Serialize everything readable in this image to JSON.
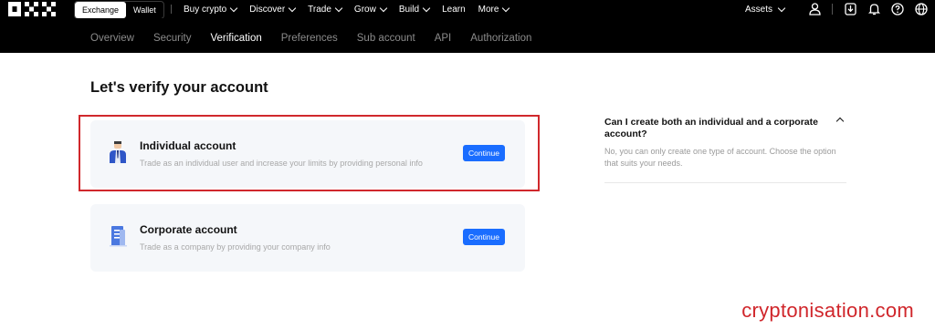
{
  "topnav": {
    "mode_tabs": [
      {
        "label": "Exchange",
        "active": true
      },
      {
        "label": "Wallet",
        "active": false
      }
    ],
    "menu": [
      {
        "label": "Buy crypto",
        "has_dropdown": true
      },
      {
        "label": "Discover",
        "has_dropdown": true
      },
      {
        "label": "Trade",
        "has_dropdown": true
      },
      {
        "label": "Grow",
        "has_dropdown": true
      },
      {
        "label": "Build",
        "has_dropdown": true
      },
      {
        "label": "Learn",
        "has_dropdown": false
      },
      {
        "label": "More",
        "has_dropdown": true
      }
    ],
    "assets_label": "Assets",
    "icons": [
      "user-icon",
      "download-icon",
      "bell-icon",
      "help-icon",
      "globe-icon"
    ]
  },
  "subnav": {
    "tabs": [
      {
        "label": "Overview",
        "active": false
      },
      {
        "label": "Security",
        "active": false
      },
      {
        "label": "Verification",
        "active": true
      },
      {
        "label": "Preferences",
        "active": false
      },
      {
        "label": "Sub account",
        "active": false
      },
      {
        "label": "API",
        "active": false
      },
      {
        "label": "Authorization",
        "active": false
      }
    ]
  },
  "main": {
    "title": "Let's verify your account",
    "cards": {
      "individual": {
        "title": "Individual account",
        "description": "Trade as an individual user and increase your limits by providing personal info",
        "button": "Continue",
        "highlighted": true
      },
      "corporate": {
        "title": "Corporate account",
        "description": "Trade as a company by providing your company info",
        "button": "Continue",
        "highlighted": false
      }
    }
  },
  "faq": {
    "question": "Can I create both an individual and a corporate account?",
    "answer": "No, you can only create one type of account. Choose the option that suits your needs.",
    "expanded": true
  },
  "watermark": "cryptonisation.com",
  "colors": {
    "nav_bg": "#000000",
    "accent": "#1a6dff",
    "card_bg": "#f5f7fa",
    "highlight_border": "#d0282c",
    "watermark": "#d0262b"
  }
}
